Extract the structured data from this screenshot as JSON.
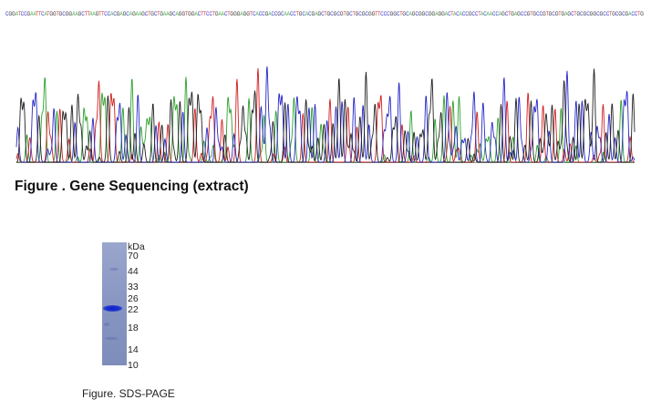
{
  "sequence": {
    "bases": "CGGATCCGAATTCATGGTGCGGAAGCTTAAGTTCCACGAGCAGAAGCTGCTGAAGCAGGTGGACTTCCTGAACTGGGAGGTCACCGACCGCAACCTGCACGAGCTGCGCGTGCTGCGCGGTTCCCGGCTGCAGCGGCGGAGGACTACACCGCCTACAACCAGCTGAGCCGTGCCGTGCGTGAGCTGCGCGGCGCCTGCGCGACCTG",
    "colors": {
      "A": "#2ea02e",
      "C": "#2828c8",
      "G": "#222222",
      "T": "#d02020"
    }
  },
  "captions": {
    "sequencing": "Figure . Gene Sequencing (extract)",
    "sds_page": "Figure. SDS-PAGE"
  },
  "gel": {
    "unit": "kDa",
    "markers": [
      "70",
      "44",
      "33",
      "26",
      "22",
      "18",
      "14",
      "10"
    ],
    "lane_color": "#8a97c3",
    "band_color": "#1428c8"
  }
}
